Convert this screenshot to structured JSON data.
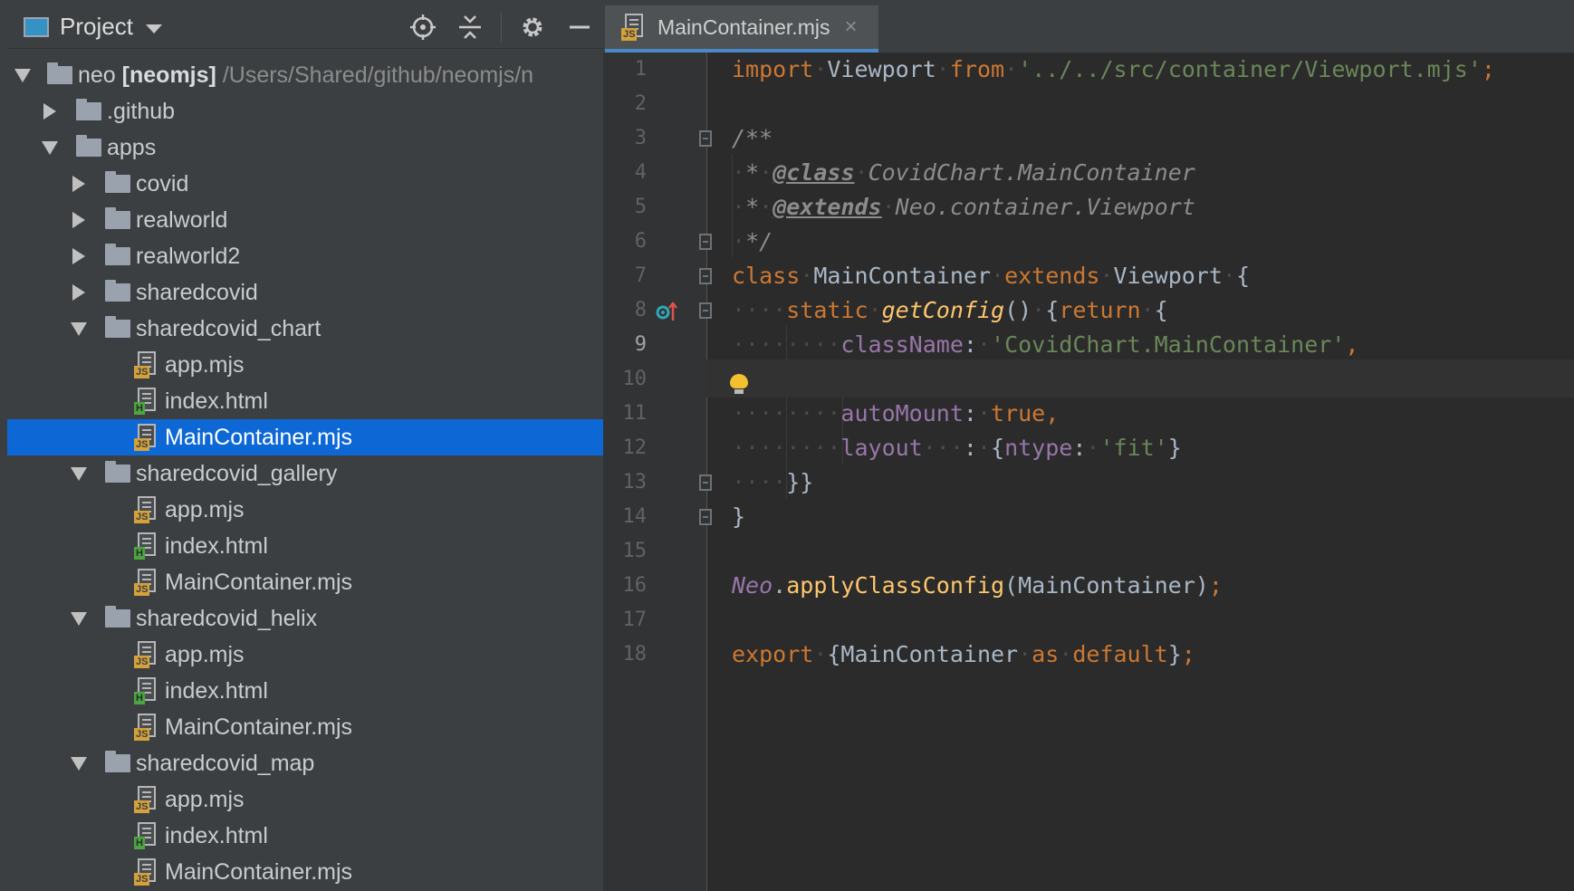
{
  "panel": {
    "title": "Project",
    "actions": [
      "locate-icon",
      "collapse-all-icon",
      "gear-icon",
      "minimize-icon"
    ]
  },
  "tree": {
    "root": {
      "name": "neo",
      "module": "[neomjs]",
      "path": "/Users/Shared/github/neomjs/n"
    },
    "items": [
      {
        "label": ".github",
        "type": "folder",
        "depth": 1,
        "state": "collapsed"
      },
      {
        "label": "apps",
        "type": "folder",
        "depth": 1,
        "state": "expanded"
      },
      {
        "label": "covid",
        "type": "folder",
        "depth": 2,
        "state": "collapsed"
      },
      {
        "label": "realworld",
        "type": "folder",
        "depth": 2,
        "state": "collapsed"
      },
      {
        "label": "realworld2",
        "type": "folder",
        "depth": 2,
        "state": "collapsed"
      },
      {
        "label": "sharedcovid",
        "type": "folder",
        "depth": 2,
        "state": "collapsed"
      },
      {
        "label": "sharedcovid_chart",
        "type": "folder",
        "depth": 2,
        "state": "expanded"
      },
      {
        "label": "app.mjs",
        "type": "js",
        "depth": 3
      },
      {
        "label": "index.html",
        "type": "html",
        "depth": 3
      },
      {
        "label": "MainContainer.mjs",
        "type": "js",
        "depth": 3,
        "selected": true
      },
      {
        "label": "sharedcovid_gallery",
        "type": "folder",
        "depth": 2,
        "state": "expanded"
      },
      {
        "label": "app.mjs",
        "type": "js",
        "depth": 3
      },
      {
        "label": "index.html",
        "type": "html",
        "depth": 3
      },
      {
        "label": "MainContainer.mjs",
        "type": "js",
        "depth": 3
      },
      {
        "label": "sharedcovid_helix",
        "type": "folder",
        "depth": 2,
        "state": "expanded"
      },
      {
        "label": "app.mjs",
        "type": "js",
        "depth": 3
      },
      {
        "label": "index.html",
        "type": "html",
        "depth": 3
      },
      {
        "label": "MainContainer.mjs",
        "type": "js",
        "depth": 3
      },
      {
        "label": "sharedcovid_map",
        "type": "folder",
        "depth": 2,
        "state": "expanded"
      },
      {
        "label": "app.mjs",
        "type": "js",
        "depth": 3
      },
      {
        "label": "index.html",
        "type": "html",
        "depth": 3
      },
      {
        "label": "MainContainer.mjs",
        "type": "js",
        "depth": 3
      }
    ]
  },
  "editor": {
    "tab": {
      "label": "MainContainer.mjs",
      "badge": "JS",
      "close": "×"
    },
    "current_line": 9,
    "lines": [
      [
        [
          "kw",
          "import"
        ],
        [
          "ws",
          "·"
        ],
        [
          "cls",
          "Viewport"
        ],
        [
          "ws",
          "·"
        ],
        [
          "kw",
          "from"
        ],
        [
          "ws",
          "·"
        ],
        [
          "str",
          "'../../src/container/Viewport.mjs'"
        ],
        [
          "kw",
          ";"
        ]
      ],
      [],
      [
        [
          "doc",
          "/**"
        ]
      ],
      [
        [
          "ws",
          "·"
        ],
        [
          "doc",
          "*"
        ],
        [
          "ws",
          "·"
        ],
        [
          "doctag",
          "@class"
        ],
        [
          "ws",
          "·"
        ],
        [
          "doc",
          "CovidChart.MainContainer"
        ]
      ],
      [
        [
          "ws",
          "·"
        ],
        [
          "doc",
          "*"
        ],
        [
          "ws",
          "·"
        ],
        [
          "doctag",
          "@extends"
        ],
        [
          "ws",
          "·"
        ],
        [
          "doc",
          "Neo.container.Viewport"
        ]
      ],
      [
        [
          "ws",
          "·"
        ],
        [
          "doc",
          "*/"
        ]
      ],
      [
        [
          "kw",
          "class"
        ],
        [
          "ws",
          "·"
        ],
        [
          "cls",
          "MainContainer"
        ],
        [
          "ws",
          "·"
        ],
        [
          "kw",
          "extends"
        ],
        [
          "ws",
          "·"
        ],
        [
          "cls",
          "Viewport"
        ],
        [
          "ws",
          "·"
        ],
        [
          "cls",
          "{"
        ]
      ],
      [
        [
          "ws",
          "····"
        ],
        [
          "kw",
          "static"
        ],
        [
          "ws",
          "·"
        ],
        [
          "fn",
          "getConfig"
        ],
        [
          "cls",
          "()"
        ],
        [
          "ws",
          "·"
        ],
        [
          "cls",
          "{"
        ],
        [
          "kw",
          "return"
        ],
        [
          "ws",
          "·"
        ],
        [
          "cls",
          "{"
        ]
      ],
      [
        [
          "ws",
          "········"
        ],
        [
          "prop",
          "className"
        ],
        [
          "cls",
          ":"
        ],
        [
          "ws",
          "·"
        ],
        [
          "str",
          "'CovidChart.MainContainer'"
        ],
        [
          "kw",
          ","
        ]
      ],
      [],
      [
        [
          "ws",
          "········"
        ],
        [
          "prop",
          "autoMount"
        ],
        [
          "cls",
          ":"
        ],
        [
          "ws",
          "·"
        ],
        [
          "kw",
          "true"
        ],
        [
          "kw",
          ","
        ]
      ],
      [
        [
          "ws",
          "········"
        ],
        [
          "prop",
          "layout"
        ],
        [
          "ws",
          "···"
        ],
        [
          "cls",
          ":"
        ],
        [
          "ws",
          "·"
        ],
        [
          "cls",
          "{"
        ],
        [
          "prop",
          "ntype"
        ],
        [
          "cls",
          ":"
        ],
        [
          "ws",
          "·"
        ],
        [
          "str",
          "'fit'"
        ],
        [
          "cls",
          "}"
        ]
      ],
      [
        [
          "ws",
          "····"
        ],
        [
          "cls",
          "}}"
        ]
      ],
      [
        [
          "cls",
          "}"
        ]
      ],
      [],
      [
        [
          "glob",
          "Neo"
        ],
        [
          "cls",
          "."
        ],
        [
          "fnplain",
          "applyClassConfig"
        ],
        [
          "cls",
          "(MainContainer)"
        ],
        [
          "kw",
          ";"
        ]
      ],
      [],
      [
        [
          "kw",
          "export"
        ],
        [
          "ws",
          "·"
        ],
        [
          "cls",
          "{MainContainer"
        ],
        [
          "ws",
          "·"
        ],
        [
          "kw",
          "as"
        ],
        [
          "ws",
          "·"
        ],
        [
          "kw",
          "default"
        ],
        [
          "cls",
          "}"
        ],
        [
          "kw",
          ";"
        ]
      ]
    ],
    "fold_lines": [
      3,
      6,
      7,
      8,
      13,
      14
    ],
    "markers": {
      "line": 8,
      "icons": [
        "override-method-icon"
      ]
    }
  }
}
